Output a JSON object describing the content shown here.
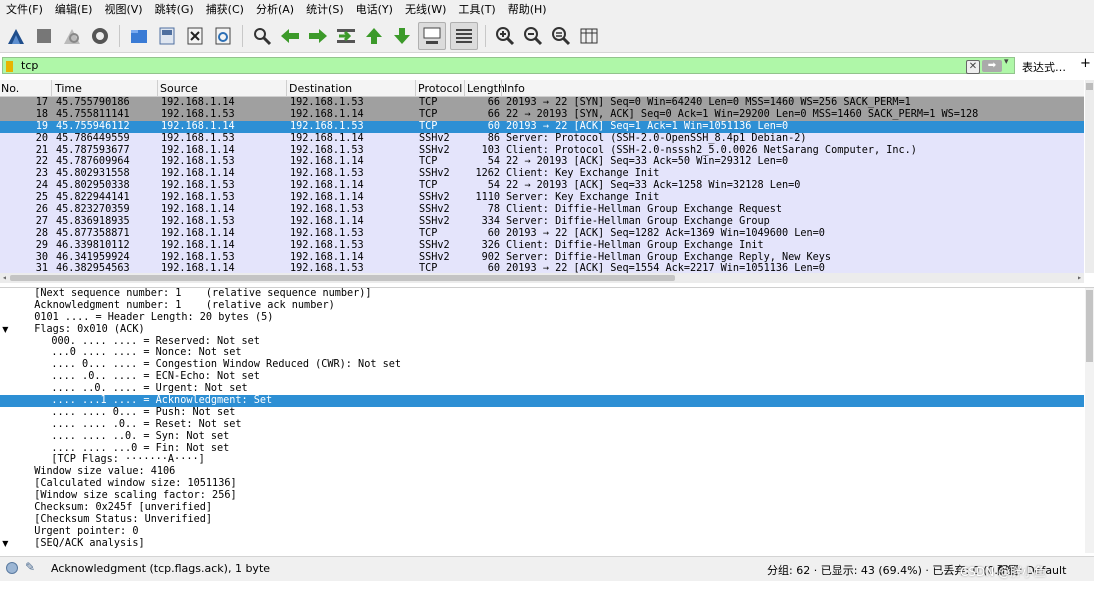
{
  "menu": [
    "文件(F)",
    "编辑(E)",
    "视图(V)",
    "跳转(G)",
    "捕获(C)",
    "分析(A)",
    "统计(S)",
    "电话(Y)",
    "无线(W)",
    "工具(T)",
    "帮助(H)"
  ],
  "toolbar_icons": [
    {
      "name": "start-capture-icon",
      "color": "#1f4e8c"
    },
    {
      "name": "stop-capture-icon",
      "color": "#777777"
    },
    {
      "name": "restart-capture-icon",
      "color": "#9a9a9a"
    },
    {
      "name": "capture-options-icon",
      "color": "#333333"
    },
    {
      "name": "open-file-icon",
      "color": "#3a7bd5"
    },
    {
      "name": "save-file-icon",
      "color": "#4f6f9f"
    },
    {
      "name": "close-file-icon",
      "color": "#444444"
    },
    {
      "name": "reload-file-icon",
      "color": "#2c6fb5"
    },
    {
      "name": "find-packet-icon",
      "color": "#333333"
    },
    {
      "name": "go-back-icon",
      "color": "#3c9a2a"
    },
    {
      "name": "go-forward-icon",
      "color": "#3c9a2a"
    },
    {
      "name": "go-to-packet-icon",
      "color": "#3c9a2a"
    },
    {
      "name": "go-first-icon",
      "color": "#3c9a2a"
    },
    {
      "name": "go-last-icon",
      "color": "#3c9a2a"
    },
    {
      "name": "autoscroll-icon",
      "color": "#444444"
    },
    {
      "name": "colorize-icon",
      "color": "#444444"
    },
    {
      "name": "zoom-in-icon",
      "color": "#333333"
    },
    {
      "name": "zoom-out-icon",
      "color": "#333333"
    },
    {
      "name": "zoom-reset-icon",
      "color": "#333333"
    },
    {
      "name": "resize-columns-icon",
      "color": "#333333"
    }
  ],
  "filter": {
    "value": "tcp",
    "expression_label": "表达式…",
    "plus_label": "+",
    "bg_color": "#aff7a8"
  },
  "packet_list": {
    "columns": [
      "No.",
      "Time",
      "Source",
      "Destination",
      "Protocol",
      "Length",
      "Info"
    ],
    "rows": [
      {
        "no": "17",
        "time": "45.755790186",
        "src": "192.168.1.14",
        "dst": "192.168.1.53",
        "proto": "TCP",
        "len": "66",
        "info": "20193 → 22 [SYN] Seq=0 Win=64240 Len=0 MSS=1460 WS=256 SACK_PERM=1",
        "style": "gray"
      },
      {
        "no": "18",
        "time": "45.755811141",
        "src": "192.168.1.53",
        "dst": "192.168.1.14",
        "proto": "TCP",
        "len": "66",
        "info": "22 → 20193 [SYN, ACK] Seq=0 Ack=1 Win=29200 Len=0 MSS=1460 SACK_PERM=1 WS=128",
        "style": "gray"
      },
      {
        "no": "19",
        "time": "45.755946112",
        "src": "192.168.1.14",
        "dst": "192.168.1.53",
        "proto": "TCP",
        "len": "60",
        "info": "20193 → 22 [ACK] Seq=1 Ack=1 Win=1051136 Len=0",
        "style": "sel"
      },
      {
        "no": "20",
        "time": "45.786449559",
        "src": "192.168.1.53",
        "dst": "192.168.1.14",
        "proto": "SSHv2",
        "len": "86",
        "info": "Server: Protocol (SSH-2.0-OpenSSH_8.4p1 Debian-2)",
        "style": "blue"
      },
      {
        "no": "21",
        "time": "45.787593677",
        "src": "192.168.1.14",
        "dst": "192.168.1.53",
        "proto": "SSHv2",
        "len": "103",
        "info": "Client: Protocol (SSH-2.0-nsssh2_5.0.0026 NetSarang Computer, Inc.)",
        "style": "blue"
      },
      {
        "no": "22",
        "time": "45.787609964",
        "src": "192.168.1.53",
        "dst": "192.168.1.14",
        "proto": "TCP",
        "len": "54",
        "info": "22 → 20193 [ACK] Seq=33 Ack=50 Win=29312 Len=0",
        "style": "blue"
      },
      {
        "no": "23",
        "time": "45.802931558",
        "src": "192.168.1.14",
        "dst": "192.168.1.53",
        "proto": "SSHv2",
        "len": "1262",
        "info": "Client: Key Exchange Init",
        "style": "blue"
      },
      {
        "no": "24",
        "time": "45.802950338",
        "src": "192.168.1.53",
        "dst": "192.168.1.14",
        "proto": "TCP",
        "len": "54",
        "info": "22 → 20193 [ACK] Seq=33 Ack=1258 Win=32128 Len=0",
        "style": "blue"
      },
      {
        "no": "25",
        "time": "45.822944141",
        "src": "192.168.1.53",
        "dst": "192.168.1.14",
        "proto": "SSHv2",
        "len": "1110",
        "info": "Server: Key Exchange Init",
        "style": "blue"
      },
      {
        "no": "26",
        "time": "45.823270359",
        "src": "192.168.1.14",
        "dst": "192.168.1.53",
        "proto": "SSHv2",
        "len": "78",
        "info": "Client: Diffie-Hellman Group Exchange Request",
        "style": "blue"
      },
      {
        "no": "27",
        "time": "45.836918935",
        "src": "192.168.1.53",
        "dst": "192.168.1.14",
        "proto": "SSHv2",
        "len": "334",
        "info": "Server: Diffie-Hellman Group Exchange Group",
        "style": "blue"
      },
      {
        "no": "28",
        "time": "45.877358871",
        "src": "192.168.1.14",
        "dst": "192.168.1.53",
        "proto": "TCP",
        "len": "60",
        "info": "20193 → 22 [ACK] Seq=1282 Ack=1369 Win=1049600 Len=0",
        "style": "blue"
      },
      {
        "no": "29",
        "time": "46.339810112",
        "src": "192.168.1.14",
        "dst": "192.168.1.53",
        "proto": "SSHv2",
        "len": "326",
        "info": "Client: Diffie-Hellman Group Exchange Init",
        "style": "blue"
      },
      {
        "no": "30",
        "time": "46.341959924",
        "src": "192.168.1.53",
        "dst": "192.168.1.14",
        "proto": "SSHv2",
        "len": "902",
        "info": "Server: Diffie-Hellman Group Exchange Reply, New Keys",
        "style": "blue"
      },
      {
        "no": "31",
        "time": "46.382954563",
        "src": "192.168.1.14",
        "dst": "192.168.1.53",
        "proto": "TCP",
        "len": "60",
        "info": "20193 → 22 [ACK] Seq=1554 Ack=2217 Win=1051136 Len=0",
        "style": "blue"
      }
    ]
  },
  "details": [
    {
      "indent": 2,
      "arrow": "",
      "text": "[Next sequence number: 1    (relative sequence number)]"
    },
    {
      "indent": 2,
      "arrow": "",
      "text": "Acknowledgment number: 1    (relative ack number)"
    },
    {
      "indent": 2,
      "arrow": "",
      "text": "0101 .... = Header Length: 20 bytes (5)"
    },
    {
      "indent": 2,
      "arrow": "▼",
      "text": "Flags: 0x010 (ACK)"
    },
    {
      "indent": 4,
      "arrow": "",
      "text": "000. .... .... = Reserved: Not set"
    },
    {
      "indent": 4,
      "arrow": "",
      "text": "...0 .... .... = Nonce: Not set"
    },
    {
      "indent": 4,
      "arrow": "",
      "text": ".... 0... .... = Congestion Window Reduced (CWR): Not set"
    },
    {
      "indent": 4,
      "arrow": "",
      "text": ".... .0.. .... = ECN-Echo: Not set"
    },
    {
      "indent": 4,
      "arrow": "",
      "text": ".... ..0. .... = Urgent: Not set"
    },
    {
      "indent": 4,
      "arrow": "",
      "text": ".... ...1 .... = Acknowledgment: Set",
      "selected": true
    },
    {
      "indent": 4,
      "arrow": "",
      "text": ".... .... 0... = Push: Not set"
    },
    {
      "indent": 4,
      "arrow": "",
      "text": ".... .... .0.. = Reset: Not set"
    },
    {
      "indent": 4,
      "arrow": "",
      "text": ".... .... ..0. = Syn: Not set"
    },
    {
      "indent": 4,
      "arrow": "",
      "text": ".... .... ...0 = Fin: Not set"
    },
    {
      "indent": 4,
      "arrow": "",
      "text": "[TCP Flags: ·······A····]"
    },
    {
      "indent": 2,
      "arrow": "",
      "text": "Window size value: 4106"
    },
    {
      "indent": 2,
      "arrow": "",
      "text": "[Calculated window size: 1051136]"
    },
    {
      "indent": 2,
      "arrow": "",
      "text": "[Window size scaling factor: 256]"
    },
    {
      "indent": 2,
      "arrow": "",
      "text": "Checksum: 0x245f [unverified]"
    },
    {
      "indent": 2,
      "arrow": "",
      "text": "[Checksum Status: Unverified]"
    },
    {
      "indent": 2,
      "arrow": "",
      "text": "Urgent pointer: 0"
    },
    {
      "indent": 2,
      "arrow": "▼",
      "text": "[SEQ/ACK analysis]"
    }
  ],
  "status": {
    "field_text": "Acknowledgment (tcp.flags.ack), 1 byte",
    "stats": "分组: 62 · 已显示: 43 (69.4%) · 已丢弃: 0 (0.0%)",
    "profile": "配置: Default",
    "watermark": "CSDN @胖小鱼"
  },
  "colors": {
    "selected_row": "#2d8fd4",
    "gray_row": "#a0a0a0",
    "tcp_row": "#e4e4fb"
  }
}
